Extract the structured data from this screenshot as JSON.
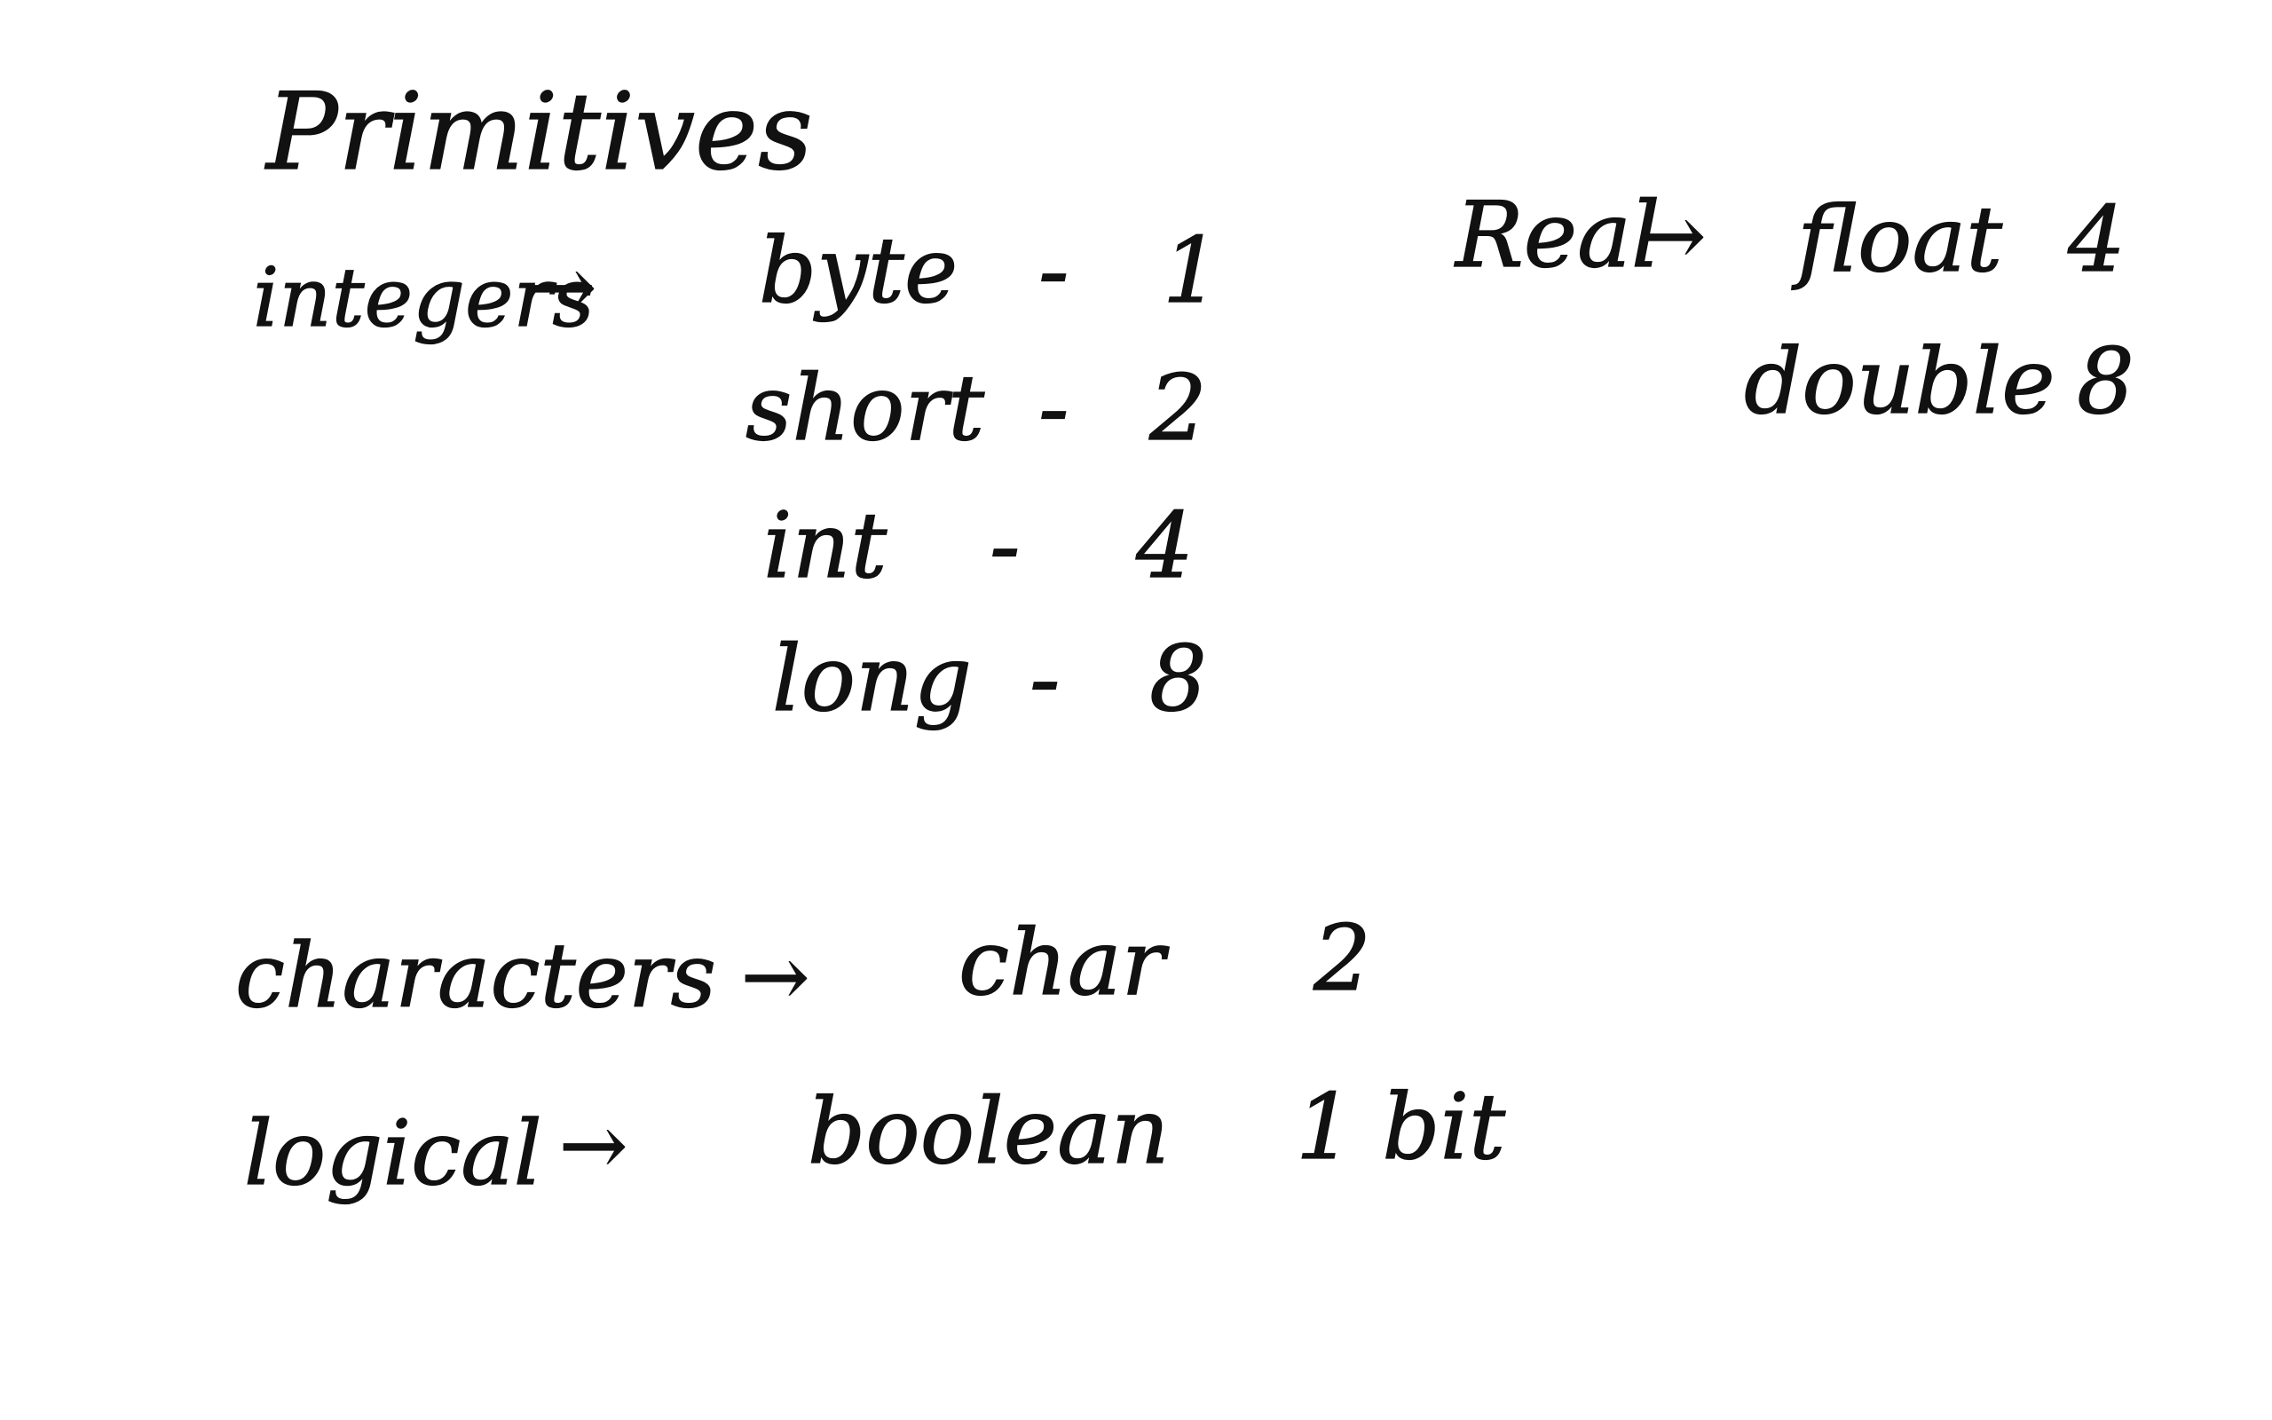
{
  "title": "Primitives",
  "groups": {
    "integers": {
      "label": "integers",
      "arrow": "→",
      "types": [
        {
          "name": "byte",
          "sep": "-",
          "size": "1"
        },
        {
          "name": "short",
          "sep": "-",
          "size": "2"
        },
        {
          "name": "int",
          "sep": "-",
          "size": "4"
        },
        {
          "name": "long",
          "sep": "-",
          "size": "8"
        }
      ]
    },
    "real": {
      "label": "Real",
      "arrow": "→",
      "types": [
        {
          "name": "float",
          "size": "4"
        },
        {
          "name": "double",
          "size": "8"
        }
      ]
    },
    "characters": {
      "label": "characters",
      "arrow": "→",
      "types": [
        {
          "name": "char",
          "size": "2"
        }
      ]
    },
    "logical": {
      "label": "logical",
      "arrow": "→",
      "types": [
        {
          "name": "boolean",
          "size": "1 bit"
        }
      ]
    }
  }
}
